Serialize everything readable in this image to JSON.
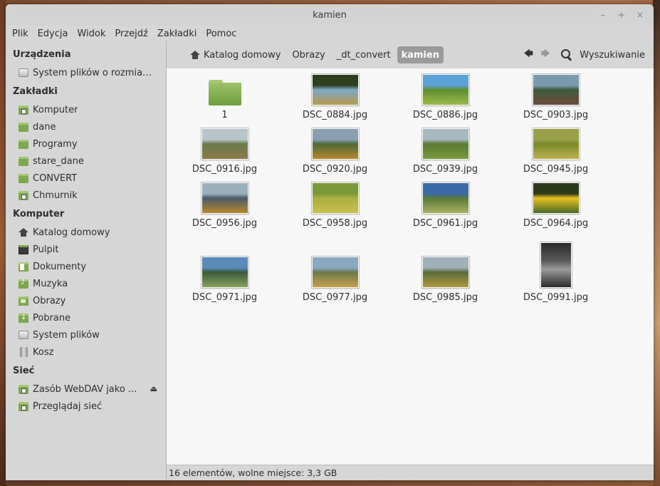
{
  "window": {
    "title": "kamien"
  },
  "window_controls": {
    "minimize": "–",
    "maximize": "+",
    "close": "×"
  },
  "menu": [
    "Plik",
    "Edycja",
    "Widok",
    "Przejdź",
    "Zakładki",
    "Pomoc"
  ],
  "sidebar": {
    "devices": {
      "header": "Urządzenia",
      "items": [
        {
          "label": "System plików o rozmiarze...",
          "icon": "drive-icon"
        }
      ]
    },
    "bookmarks": {
      "header": "Zakładki",
      "items": [
        {
          "label": "Komputer",
          "icon": "network-folder-icon"
        },
        {
          "label": "dane",
          "icon": "folder-icon"
        },
        {
          "label": "Programy",
          "icon": "folder-icon"
        },
        {
          "label": "stare_dane",
          "icon": "folder-icon"
        },
        {
          "label": "CONVERT",
          "icon": "folder-icon"
        },
        {
          "label": "Chmurnik",
          "icon": "network-folder-icon"
        }
      ]
    },
    "computer": {
      "header": "Komputer",
      "items": [
        {
          "label": "Katalog domowy",
          "icon": "home-icon"
        },
        {
          "label": "Pulpit",
          "icon": "desktop-icon"
        },
        {
          "label": "Dokumenty",
          "icon": "documents-icon"
        },
        {
          "label": "Muzyka",
          "icon": "music-icon"
        },
        {
          "label": "Obrazy",
          "icon": "pictures-icon"
        },
        {
          "label": "Pobrane",
          "icon": "downloads-icon"
        },
        {
          "label": "System plików",
          "icon": "drive-icon"
        },
        {
          "label": "Kosz",
          "icon": "trash-icon"
        }
      ]
    },
    "network": {
      "header": "Sieć",
      "items": [
        {
          "label": "Zasób WebDAV jako ...",
          "icon": "network-folder-icon",
          "eject": "⏏"
        },
        {
          "label": "Przeglądaj sieć",
          "icon": "network-folder-icon"
        }
      ]
    }
  },
  "breadcrumb": {
    "items": [
      "Katalog domowy",
      "Obrazy",
      "_dt_convert",
      "kamien"
    ],
    "active_index": 3
  },
  "nav": {
    "back": "🡄",
    "forward": "🡆",
    "search_label": "Wyszukiwanie"
  },
  "files": [
    {
      "name": "1",
      "type": "folder"
    },
    {
      "name": "DSC_0884.jpg",
      "type": "image",
      "palette": [
        "#2e3f1e",
        "#7da8c9",
        "#b89a4a"
      ]
    },
    {
      "name": "DSC_0886.jpg",
      "type": "image",
      "palette": [
        "#5aa2d8",
        "#5f8f2e",
        "#9cb84a"
      ]
    },
    {
      "name": "DSC_0903.jpg",
      "type": "image",
      "palette": [
        "#7b9ab0",
        "#3e5a3a",
        "#6e4a3a"
      ]
    },
    {
      "name": "DSC_0916.jpg",
      "type": "image",
      "palette": [
        "#b8c6cc",
        "#6a7a4a",
        "#8a7a4a"
      ]
    },
    {
      "name": "DSC_0920.jpg",
      "type": "image",
      "palette": [
        "#8aa0b2",
        "#4d6a36",
        "#b8862e"
      ]
    },
    {
      "name": "DSC_0939.jpg",
      "type": "image",
      "palette": [
        "#a8b8c0",
        "#5a7a30",
        "#7a9a3a"
      ]
    },
    {
      "name": "DSC_0945.jpg",
      "type": "image",
      "palette": [
        "#9aa04a",
        "#7a8a2a",
        "#c0b050"
      ]
    },
    {
      "name": "DSC_0956.jpg",
      "type": "image",
      "palette": [
        "#9ab0bc",
        "#4a5a6a",
        "#b8862e"
      ]
    },
    {
      "name": "DSC_0958.jpg",
      "type": "image",
      "palette": [
        "#7a9a3a",
        "#a8b040",
        "#c8c050"
      ]
    },
    {
      "name": "DSC_0961.jpg",
      "type": "image",
      "palette": [
        "#3a6aa8",
        "#5a7a3a",
        "#a8b060"
      ]
    },
    {
      "name": "DSC_0964.jpg",
      "type": "image",
      "palette": [
        "#2a3a1a",
        "#e8c020",
        "#4a6a2a"
      ]
    },
    {
      "name": "DSC_0971.jpg",
      "type": "image",
      "palette": [
        "#5a8ab8",
        "#3a5a3a",
        "#8aa060"
      ]
    },
    {
      "name": "DSC_0977.jpg",
      "type": "image",
      "palette": [
        "#8aa8c0",
        "#6a7a4a",
        "#c8a050"
      ]
    },
    {
      "name": "DSC_0985.jpg",
      "type": "image",
      "palette": [
        "#a0b0b8",
        "#5a6a3a",
        "#b09a40"
      ]
    },
    {
      "name": "DSC_0991.jpg",
      "type": "image",
      "palette": [
        "#2a2a2a",
        "#9a9a9a",
        "#5a5a5a"
      ]
    }
  ],
  "status": "16 elementów, wolne miejsce: 3,3 GB"
}
